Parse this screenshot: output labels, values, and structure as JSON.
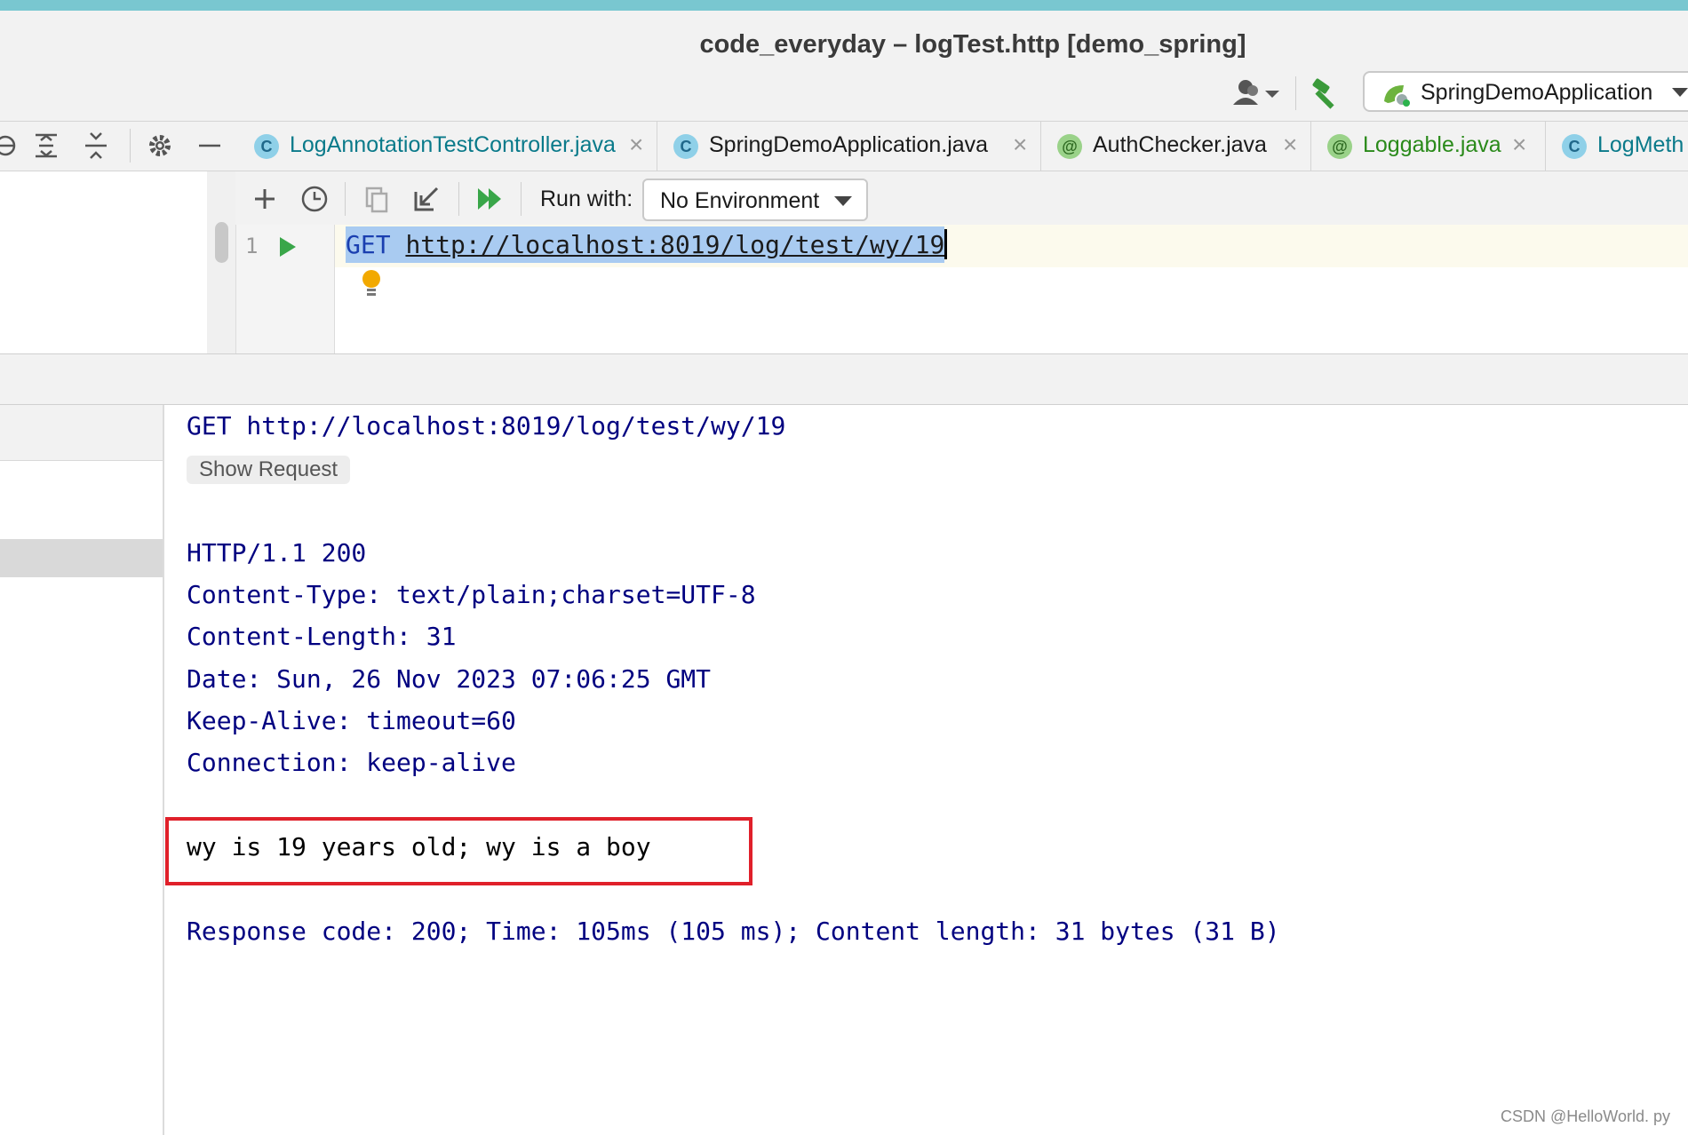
{
  "window": {
    "title": "code_everyday – logTest.http [demo_spring]"
  },
  "toolbar": {
    "run_config": "SpringDemoApplication"
  },
  "tabs": [
    {
      "label": "LogAnnotationTestController.java",
      "badge": "C",
      "color": "#0a7a8a"
    },
    {
      "label": "SpringDemoApplication.java",
      "badge": "C",
      "color": "#1a1a1a"
    },
    {
      "label": "AuthChecker.java",
      "badge": "@",
      "color": "#1a1a1a"
    },
    {
      "label": "Loggable.java",
      "badge": "@",
      "color": "#2a8a1a"
    },
    {
      "label": "LogMeth",
      "badge": "C",
      "color": "#0a7a8a"
    }
  ],
  "request_toolbar": {
    "run_with_label": "Run with:",
    "environment": "No Environment"
  },
  "editor": {
    "line_number": "1",
    "method": "GET",
    "url": "http://localhost:8019/log/test/wy/19"
  },
  "response": {
    "request_line": "GET http://localhost:8019/log/test/wy/19",
    "show_request": "Show Request",
    "status_line": "HTTP/1.1 200",
    "headers": [
      "Content-Type: text/plain;charset=UTF-8",
      "Content-Length: 31",
      "Date: Sun, 26 Nov 2023 07:06:25 GMT",
      "Keep-Alive: timeout=60",
      "Connection: keep-alive"
    ],
    "body": "wy is 19 years old; wy is a boy",
    "summary": "Response code: 200; Time: 105ms (105 ms); Content length: 31 bytes (31 B)"
  },
  "watermark": "CSDN @HelloWorld. py"
}
